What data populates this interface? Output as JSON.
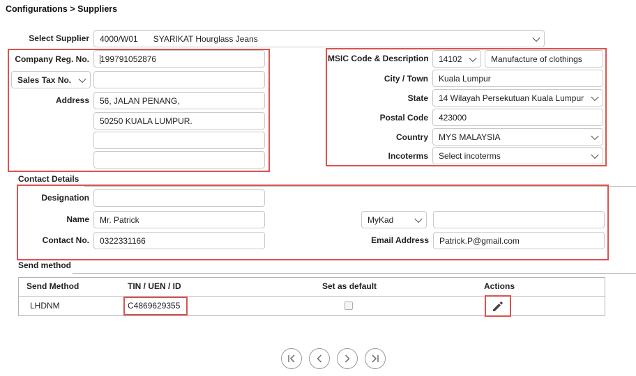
{
  "breadcrumb": "Configurations > Suppliers",
  "supplier": {
    "label": "Select Supplier",
    "code": "4000/W01",
    "name": "SYARIKAT Hourglass Jeans"
  },
  "company": {
    "reg_label": "Company Reg. No.",
    "reg_value": "199791052876",
    "tax_select": "Sales Tax No.",
    "tax_value": "",
    "address_label": "Address",
    "address_lines": [
      "56, JALAN PENANG,",
      "50250 KUALA LUMPUR.",
      "",
      ""
    ]
  },
  "location": {
    "msic_label": "MSIC Code & Description",
    "msic_code": "14102",
    "msic_desc": "Manufacture of clothings",
    "city_label": "City / Town",
    "city_value": "Kuala Lumpur",
    "state_label": "State",
    "state_value": "14 Wilayah Persekutuan Kuala Lumpur",
    "postal_label": "Postal Code",
    "postal_value": "423000",
    "country_label": "Country",
    "country_value": "MYS MALAYSIA",
    "incoterms_label": "Incoterms",
    "incoterms_value": "Select incoterms"
  },
  "contact": {
    "section_title": "Contact Details",
    "designation_label": "Designation",
    "designation_value": "",
    "name_label": "Name",
    "name_value": "Mr. Patrick",
    "contact_label": "Contact No.",
    "contact_value": "0322331166",
    "id_type": "MyKad",
    "id_value": "",
    "email_label": "Email Address",
    "email_value": "Patrick.P@gmail.com"
  },
  "send_method": {
    "section_title": "Send method",
    "headers": [
      "Send Method",
      "TIN / UEN / ID",
      "Set as default",
      "Actions"
    ],
    "rows": [
      {
        "method": "LHDNM",
        "tin": "C4869629355",
        "is_default": false
      }
    ]
  },
  "icons": {
    "edit": "pencil-icon",
    "first": "first-page-icon",
    "prev": "prev-page-icon",
    "next": "next-page-icon",
    "last": "last-page-icon"
  },
  "colors": {
    "highlight": "#d9534f",
    "border": "#c9c9c9"
  }
}
